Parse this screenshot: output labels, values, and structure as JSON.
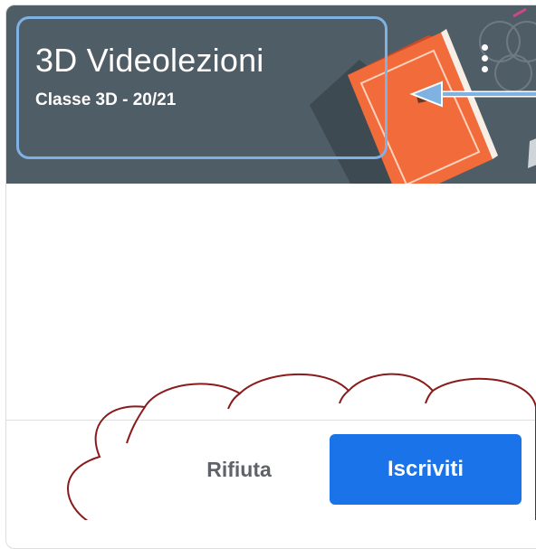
{
  "card": {
    "title": "3D Videolezioni",
    "subtitle": "Classe 3D - 20/21",
    "more_icon": "more-vert-icon",
    "illustration": "book-illustration",
    "reject_label": "Rifiuta",
    "join_label": "Iscriviti"
  },
  "colors": {
    "banner": "#4f5d66",
    "accent": "#1a73e8",
    "annotation_box": "#7fb2e3",
    "annotation_cloud": "#8b1a1a",
    "book": "#f26b3a"
  }
}
